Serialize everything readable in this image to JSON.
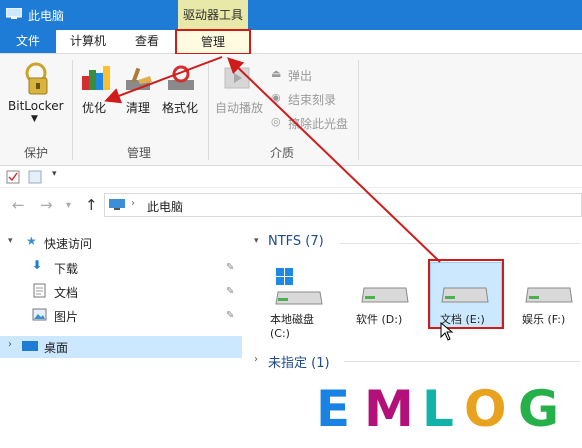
{
  "window": {
    "title": "此电脑",
    "contextual_tab_group": "驱动器工具"
  },
  "tabs": {
    "file": "文件",
    "computer": "计算机",
    "view": "查看",
    "manage": "管理"
  },
  "ribbon": {
    "bitlocker": "BitLocker",
    "optimize": "优化",
    "cleanup": "清理",
    "format": "格式化",
    "autoplay": "自动播放",
    "eject": "弹出",
    "finish_burning": "结束刻录",
    "erase_disc": "擦除此光盘",
    "group_protect": "保护",
    "group_manage": "管理",
    "group_media": "介质"
  },
  "address": {
    "path": "此电脑"
  },
  "nav": {
    "quick_access": "快速访问",
    "downloads": "下载",
    "documents": "文档",
    "pictures": "图片",
    "desktop": "桌面"
  },
  "content": {
    "group1_header": "NTFS (7)",
    "group2_header": "未指定 (1)",
    "drives": [
      {
        "name": "本地磁盘",
        "letter": "(C:)"
      },
      {
        "name": "软件 (D:)"
      },
      {
        "name": "文档 (E:)"
      },
      {
        "name": "娱乐 (F:)"
      }
    ]
  },
  "watermark": {
    "letters": [
      "E",
      "M",
      "L",
      "O",
      "G"
    ]
  },
  "colors": {
    "titlebar": "#1e7bd6",
    "contextual_tab": "#e8e8a8",
    "selection": "#cce8ff",
    "highlight_red": "#d11a1a",
    "watermark": [
      "#1a82e2",
      "#b3107a",
      "#11b3a8",
      "#e8a21e",
      "#25b04a"
    ]
  },
  "icons": [
    "this-pc-icon",
    "bitlocker-key-icon",
    "optimize-icon",
    "cleanup-icon",
    "format-icon",
    "autoplay-icon",
    "eject-icon",
    "burn-icon",
    "erase-icon",
    "windows-drive-icon",
    "hdd-icon",
    "mouse-cursor-icon"
  ]
}
